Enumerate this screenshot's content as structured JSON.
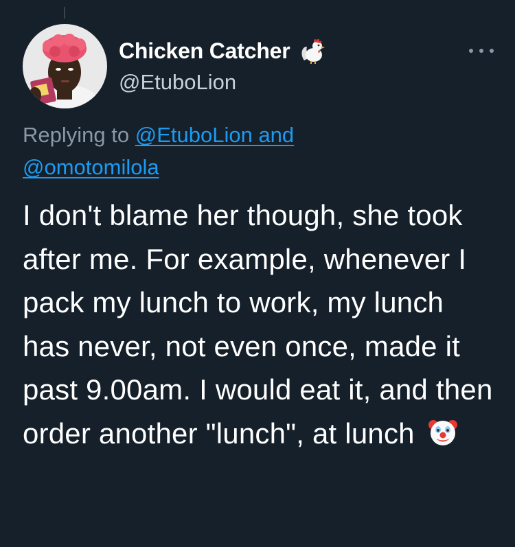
{
  "tweet": {
    "author": {
      "display_name": "Chicken Catcher",
      "handle": "@EtuboLion",
      "avatar": "profile-photo",
      "name_emoji": "rooster-icon"
    },
    "menu_icon": "more-horizontal-icon",
    "replying": {
      "prefix": "Replying to",
      "user1": "@EtuboLion",
      "connector": "and",
      "user2": "@omotomilola"
    },
    "body_text": "I don't blame her though, she took after me. For example, whenever I pack my lunch to work, my lunch has never, not even once, made it past 9.00am. I would eat it, and then order another \"lunch\", at lunch",
    "trailing_emoji": "clown-face-icon"
  },
  "colors": {
    "background": "#15202b",
    "text_primary": "#ffffff",
    "text_secondary": "#8b98a5",
    "link": "#1d9bf0"
  }
}
